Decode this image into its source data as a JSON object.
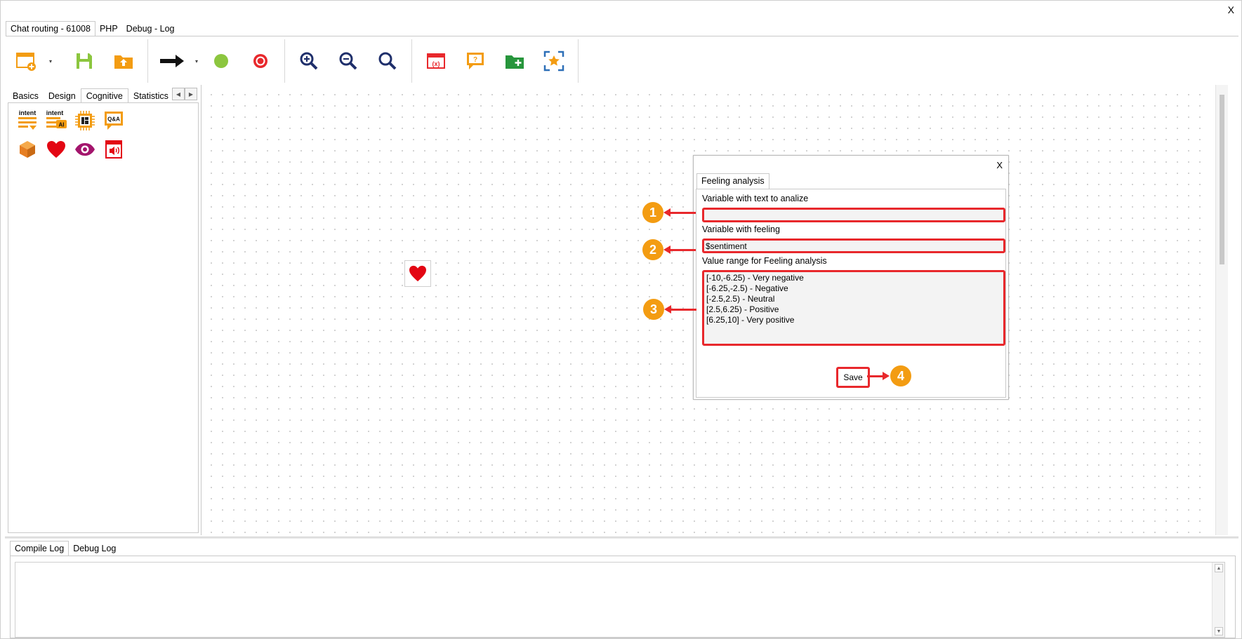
{
  "window": {
    "close_label": "X"
  },
  "top_tabs": [
    {
      "label": "Chat routing - 61008"
    },
    {
      "label": "PHP"
    },
    {
      "label": "Debug - Log"
    }
  ],
  "toolbar": {
    "items": [
      {
        "icon": "new-window-icon"
      },
      {
        "icon": "save-icon"
      },
      {
        "icon": "upload-folder-icon"
      },
      {
        "icon": "arrow-right-icon"
      },
      {
        "icon": "start-node-icon"
      },
      {
        "icon": "end-node-icon"
      },
      {
        "icon": "zoom-in-icon"
      },
      {
        "icon": "zoom-out-icon"
      },
      {
        "icon": "zoom-reset-icon"
      },
      {
        "icon": "variables-icon"
      },
      {
        "icon": "help-chat-icon"
      },
      {
        "icon": "add-folder-icon"
      },
      {
        "icon": "fit-to-screen-icon"
      }
    ],
    "colors": {
      "accent_orange": "#f39c12",
      "green": "#8cc63f",
      "red": "#e8282c",
      "navy": "#1f2f6b",
      "folder_green": "#27963c"
    }
  },
  "left_panel": {
    "tabs": [
      {
        "label": "Basics"
      },
      {
        "label": "Design"
      },
      {
        "label": "Cognitive"
      },
      {
        "label": "Statistics"
      }
    ],
    "active_tab": "Cognitive",
    "icons": [
      {
        "icon": "intent-icon",
        "caption": "intent"
      },
      {
        "icon": "intent-ai-icon",
        "caption": "intent",
        "badge": "AI"
      },
      {
        "icon": "processor-chip-icon"
      },
      {
        "icon": "qna-icon",
        "caption": "Q&A"
      },
      {
        "icon": "package-box-icon"
      },
      {
        "icon": "heart-icon"
      },
      {
        "icon": "eye-icon"
      },
      {
        "icon": "speaker-card-icon"
      }
    ]
  },
  "canvas": {
    "node_icon": "heart-icon"
  },
  "dialog": {
    "close_label": "X",
    "tab_label": "Feeling analysis",
    "field1": {
      "label": "Variable with text to analize",
      "value": ""
    },
    "field2": {
      "label": "Variable with feeling",
      "value": "$sentiment"
    },
    "field3": {
      "label": "Value range for Feeling analysis",
      "value": "[-10,-6.25) - Very negative\n[-6.25,-2.5) - Negative\n[-2.5,2.5) - Neutral\n[2.5,6.25) - Positive\n[6.25,10] - Very positive"
    },
    "save_label": "Save"
  },
  "annotations": [
    {
      "number": "1"
    },
    {
      "number": "2"
    },
    {
      "number": "3"
    },
    {
      "number": "4"
    }
  ],
  "bottom_panel": {
    "tabs": [
      {
        "label": "Compile Log"
      },
      {
        "label": "Debug Log"
      }
    ],
    "active_tab": "Compile Log"
  }
}
